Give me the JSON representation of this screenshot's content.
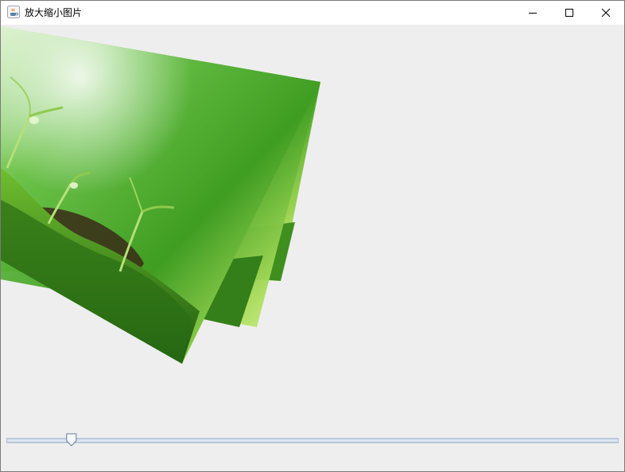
{
  "window": {
    "title": "放大缩小图片",
    "app_icon": "java-cup-icon",
    "controls": {
      "minimize_icon": "minimize-icon",
      "maximize_icon": "maximize-icon",
      "close_icon": "close-icon"
    }
  },
  "canvas": {
    "image_description_icon": "green-seedlings-photo",
    "copies": 3
  },
  "slider": {
    "value_fraction": 0.1
  },
  "colors": {
    "background": "#eeeeee",
    "titlebar": "#ffffff",
    "slider_track": "#b8cfe5"
  }
}
